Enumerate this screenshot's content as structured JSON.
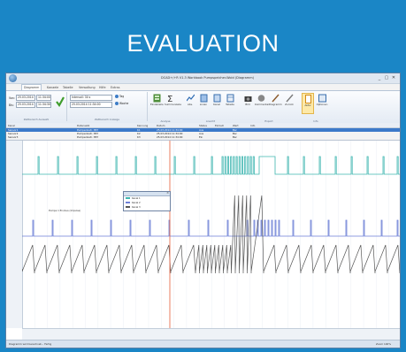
{
  "banner": {
    "title": "EVALUATION"
  },
  "window": {
    "title": "DCAD+/+R V1.3 Workbook Pumpspeicher-Wold (Diagramm)",
    "controls": [
      "_",
      "▢",
      "✕"
    ]
  },
  "tabs": [
    "Diagramm",
    "Kanaele",
    "Tabelle",
    "Verwaltung",
    "Hilfe",
    "Extras"
  ],
  "ribbon": {
    "time_group": {
      "label": "Zeitbereich Auswahl",
      "from_label": "Von:",
      "from_date": "25.03.2014",
      "from_time": "11:34:00",
      "to_label": "Bis:",
      "to_date": "25.03.2014",
      "to_time": "11:34:30"
    },
    "zoom_group": {
      "label": "Zeitbereich Anzeige",
      "field1": "Intervall: 30 s",
      "field2": "25.03.2014 11:34:00",
      "opt1": "Tag",
      "opt2": "Woche"
    },
    "buttons": [
      {
        "label": "Einzelzeile",
        "group": "Analyse"
      },
      {
        "label": "Summenzeile",
        "group": "Analyse"
      },
      {
        "label": "Abs.",
        "group": "Ansicht"
      },
      {
        "label": "Linien",
        "group": "Ansicht"
      },
      {
        "label": "Kanal",
        "group": "Ansicht"
      },
      {
        "label": "Tabelle",
        "group": "Ansicht"
      },
      {
        "label": "Bild",
        "group": "Export"
      },
      {
        "label": "Kommentar",
        "group": "Export"
      },
      {
        "label": "Diagramm",
        "group": "Export"
      },
      {
        "label": "Zurück",
        "group": "Export"
      },
      {
        "label": "Aktiv",
        "group": "Info"
      },
      {
        "label": "Optionen",
        "group": "Info"
      }
    ],
    "group_labels": [
      "Analyse",
      "Ansicht",
      "Export",
      "Info"
    ]
  },
  "list": {
    "headers": [
      "Kanal",
      "Datensatz",
      "Kennung",
      "Datum",
      "Status",
      "Einheit",
      "Wert",
      "Info"
    ],
    "rows": [
      {
        "cells": [
          "Sensor1",
          "Pumpenbetr. 3B7",
          "K1",
          "25.03.2014 11:34:00",
          "Aus",
          "Bar"
        ]
      },
      {
        "cells": [
          "Sensor2",
          "Pumpenbetr. 3B7",
          "K2",
          "25.03.2014 11:34:00",
          "Aus",
          "Bar"
        ]
      },
      {
        "cells": [
          "Sensor3",
          "Pumpenbetr. 3B7",
          "K3",
          "25.03.2014 11:34:00",
          "Ein",
          "Bar"
        ]
      }
    ]
  },
  "chart": {
    "legend_rows": [
      {
        "name": "Kanal 1",
        "color": "#3fb6b0"
      },
      {
        "name": "Kanal 2",
        "color": "#6c7fd6"
      },
      {
        "name": "Kanal 3",
        "color": "#555555"
      }
    ],
    "annotation": "Pumpe 1 Ein/Aus (Impulse)",
    "cursor_color": "#e45c3a"
  },
  "status": {
    "left": "Diagramm wird berechnet... Fertig",
    "right": "Zoom 100%"
  }
}
